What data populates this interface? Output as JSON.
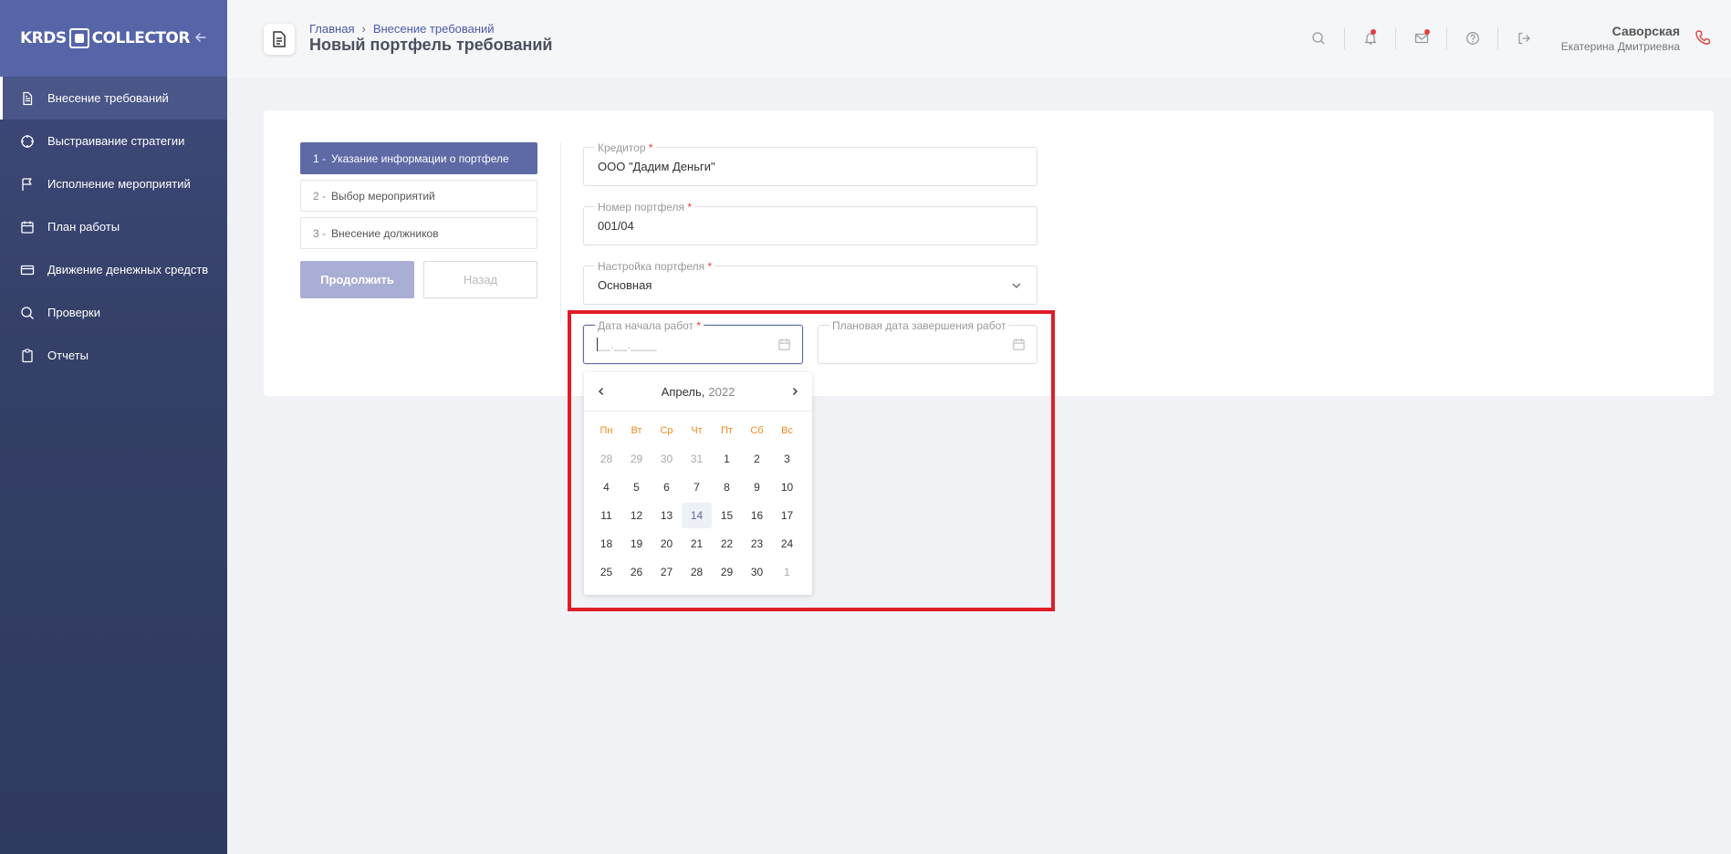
{
  "sidebar": {
    "logo_text_left": "KRDS",
    "logo_text_right": "COLLECTOR",
    "items": [
      {
        "label": "Внесение требований",
        "icon": "document-icon"
      },
      {
        "label": "Выстраивание стратегии",
        "icon": "crosshair-icon"
      },
      {
        "label": "Исполнение мероприятий",
        "icon": "flag-icon"
      },
      {
        "label": "План работы",
        "icon": "calendar-icon"
      },
      {
        "label": "Движение денежных средств",
        "icon": "credit-card-icon"
      },
      {
        "label": "Проверки",
        "icon": "search-icon"
      },
      {
        "label": "Отчеты",
        "icon": "clipboard-icon"
      }
    ]
  },
  "header": {
    "breadcrumb": [
      "Главная",
      "Внесение требований"
    ],
    "title": "Новый портфель требований",
    "user": {
      "name": "Саворская",
      "sub": "Екатерина Дмитриевна"
    }
  },
  "steps": [
    {
      "num": "1 -",
      "label": "Указание информации о портфеле"
    },
    {
      "num": "2 -",
      "label": "Выбор мероприятий"
    },
    {
      "num": "3 -",
      "label": "Внесение должников"
    }
  ],
  "buttons": {
    "continue": "Продолжить",
    "back": "Назад"
  },
  "form": {
    "creditor": {
      "label": "Кредитор",
      "value": "ООО \"Дадим Деньги\""
    },
    "portfolio_number": {
      "label": "Номер портфеля",
      "value": "001/04"
    },
    "portfolio_setting": {
      "label": "Настройка портфеля",
      "value": "Основная"
    },
    "start_date": {
      "label": "Дата начала работ",
      "mask": "__.__.____"
    },
    "end_date": {
      "label": "Плановая дата завершения работ"
    },
    "required_mark": "*"
  },
  "calendar": {
    "month": "Апрель,",
    "year": "2022",
    "weekdays": [
      "Пн",
      "Вт",
      "Ср",
      "Чт",
      "Пт",
      "Сб",
      "Вс"
    ],
    "weeks": [
      [
        "28",
        "29",
        "30",
        "31",
        "1",
        "2",
        "3"
      ],
      [
        "4",
        "5",
        "6",
        "7",
        "8",
        "9",
        "10"
      ],
      [
        "11",
        "12",
        "13",
        "14",
        "15",
        "16",
        "17"
      ],
      [
        "18",
        "19",
        "20",
        "21",
        "22",
        "23",
        "24"
      ],
      [
        "25",
        "26",
        "27",
        "28",
        "29",
        "30",
        "1"
      ]
    ],
    "muted": [
      [
        0,
        0
      ],
      [
        0,
        1
      ],
      [
        0,
        2
      ],
      [
        0,
        3
      ],
      [
        4,
        6
      ]
    ],
    "today": [
      2,
      3
    ]
  },
  "colors": {
    "accent": "#5e6aa5",
    "weekday": "#f08a1d",
    "highlight": "#e01d26",
    "required": "#e0413c"
  }
}
